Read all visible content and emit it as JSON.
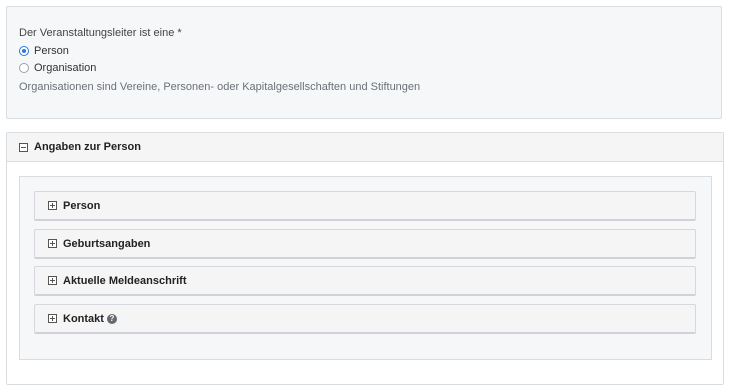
{
  "organizer": {
    "question": "Der Veranstaltungsleiter ist eine *",
    "options": [
      {
        "label": "Person",
        "selected": true
      },
      {
        "label": "Organisation",
        "selected": false
      }
    ],
    "help": "Organisationen sind Vereine, Personen- oder Kapitalgesellschaften und Stiftungen"
  },
  "person_panel": {
    "title": "Angaben zur Person",
    "toggle_icon": "collapse-minus-icon",
    "sections": [
      {
        "label": "Person",
        "icon": "expand-plus-icon"
      },
      {
        "label": "Geburtsangaben",
        "icon": "expand-plus-icon"
      },
      {
        "label": "Aktuelle Meldeanschrift",
        "icon": "expand-plus-icon"
      },
      {
        "label": "Kontakt",
        "icon": "expand-plus-icon",
        "help_icon": "?"
      }
    ]
  },
  "colors": {
    "accent": "#2a7ae2",
    "panel_bg": "#f5f7f9",
    "border": "#d8dde2"
  }
}
